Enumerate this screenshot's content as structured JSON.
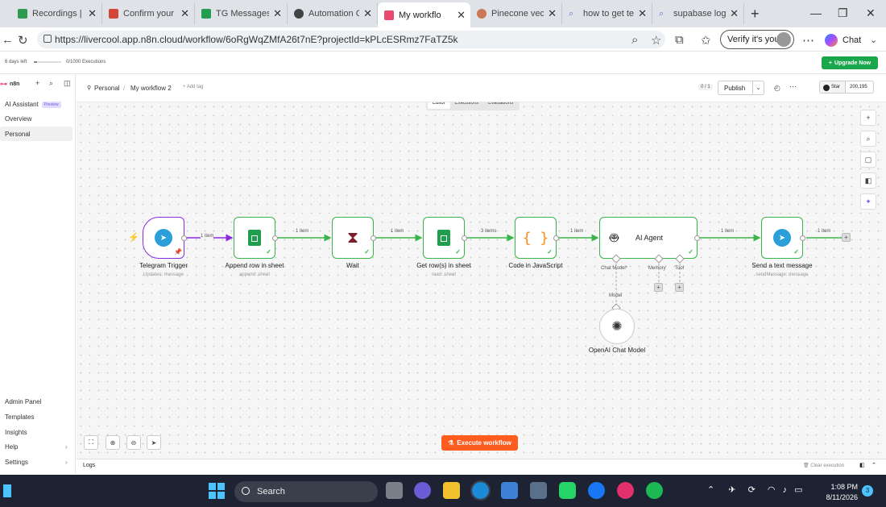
{
  "browser": {
    "tabs": [
      {
        "title": "Recordings | Ne",
        "icon": "guru-icon",
        "color": "#2e9b4f"
      },
      {
        "title": "Confirm your e",
        "icon": "gmail-icon",
        "color": "#d44638"
      },
      {
        "title": "TG Messages -",
        "icon": "sheets-icon",
        "color": "#1e9e4e"
      },
      {
        "title": "Automation Ch",
        "icon": "openai-icon",
        "color": "#444444"
      },
      {
        "title": "My workflo",
        "icon": "n8n-icon",
        "color": "#ea4b71"
      },
      {
        "title": "Pinecone vecto",
        "icon": "pinecone-icon",
        "color": "#cc7755"
      },
      {
        "title": "how to get tele",
        "icon": "search-icon",
        "color": "#5a7fd6"
      },
      {
        "title": "supabase login",
        "icon": "search-icon",
        "color": "#5a7fd6"
      }
    ],
    "new_tab": "+",
    "url": "https://livercool.app.n8n.cloud/workflow/6oRgWqZMfA26t7nE?projectId=kPLcESRmz7FaTZ5k",
    "verify_label": "Verify it's you",
    "chat_label": "Chat"
  },
  "trial": {
    "days_left": "6 days left",
    "executions": "0/1000 Executions",
    "upgrade_label": "Upgrade Now",
    "upgrade_color": "#1aa64b"
  },
  "sidebar": {
    "logo": "n8n",
    "top_items": [
      {
        "label": "AI Assistant",
        "badge": "Preview"
      },
      {
        "label": "Overview"
      },
      {
        "label": "Personal"
      }
    ],
    "bottom_items": [
      {
        "label": "Admin Panel"
      },
      {
        "label": "Templates"
      },
      {
        "label": "Insights"
      },
      {
        "label": "Help"
      },
      {
        "label": "Settings"
      }
    ]
  },
  "header": {
    "breadcrumb_project": "Personal",
    "separator": "/",
    "workflow_name": "My workflow 2",
    "add_tag": "+ Add tag",
    "counter": "0 / 1",
    "publish_label": "Publish",
    "star_label": "Star",
    "star_count": "200,195"
  },
  "mode_tabs": [
    "Editor",
    "Executions",
    "Evaluations"
  ],
  "nodes": {
    "telegram_trigger": {
      "label": "Telegram Trigger",
      "sub": "Updates: message"
    },
    "append_row": {
      "label": "Append row in sheet",
      "sub": "append: sheet"
    },
    "wait": {
      "label": "Wait"
    },
    "get_rows": {
      "label": "Get row(s) in sheet",
      "sub": "read: sheet"
    },
    "code": {
      "label": "Code in JavaScript"
    },
    "ai_agent": {
      "label": "AI Agent",
      "chat_model": "Chat Model*",
      "memory": "Memory",
      "tool": "Tool"
    },
    "send_message": {
      "label": "Send a text message",
      "sub": "sendMessage: message"
    },
    "openai_model": {
      "label": "OpenAI Chat Model",
      "connector": "Model"
    }
  },
  "edges": {
    "e1": "1 item",
    "e2": "1 item",
    "e3": "1 item",
    "e4": "3 items",
    "e5": "1 item",
    "e6": "1 item",
    "e7": "1 item"
  },
  "canvas": {
    "execute_label": "Execute workflow",
    "execute_color": "#ff5c1f"
  },
  "logs": {
    "label": "Logs",
    "clear_label": "Clear execution"
  },
  "taskbar": {
    "search_label": "Search",
    "time": "1:08 PM",
    "date": "8/11/2026",
    "notifications": "3"
  }
}
